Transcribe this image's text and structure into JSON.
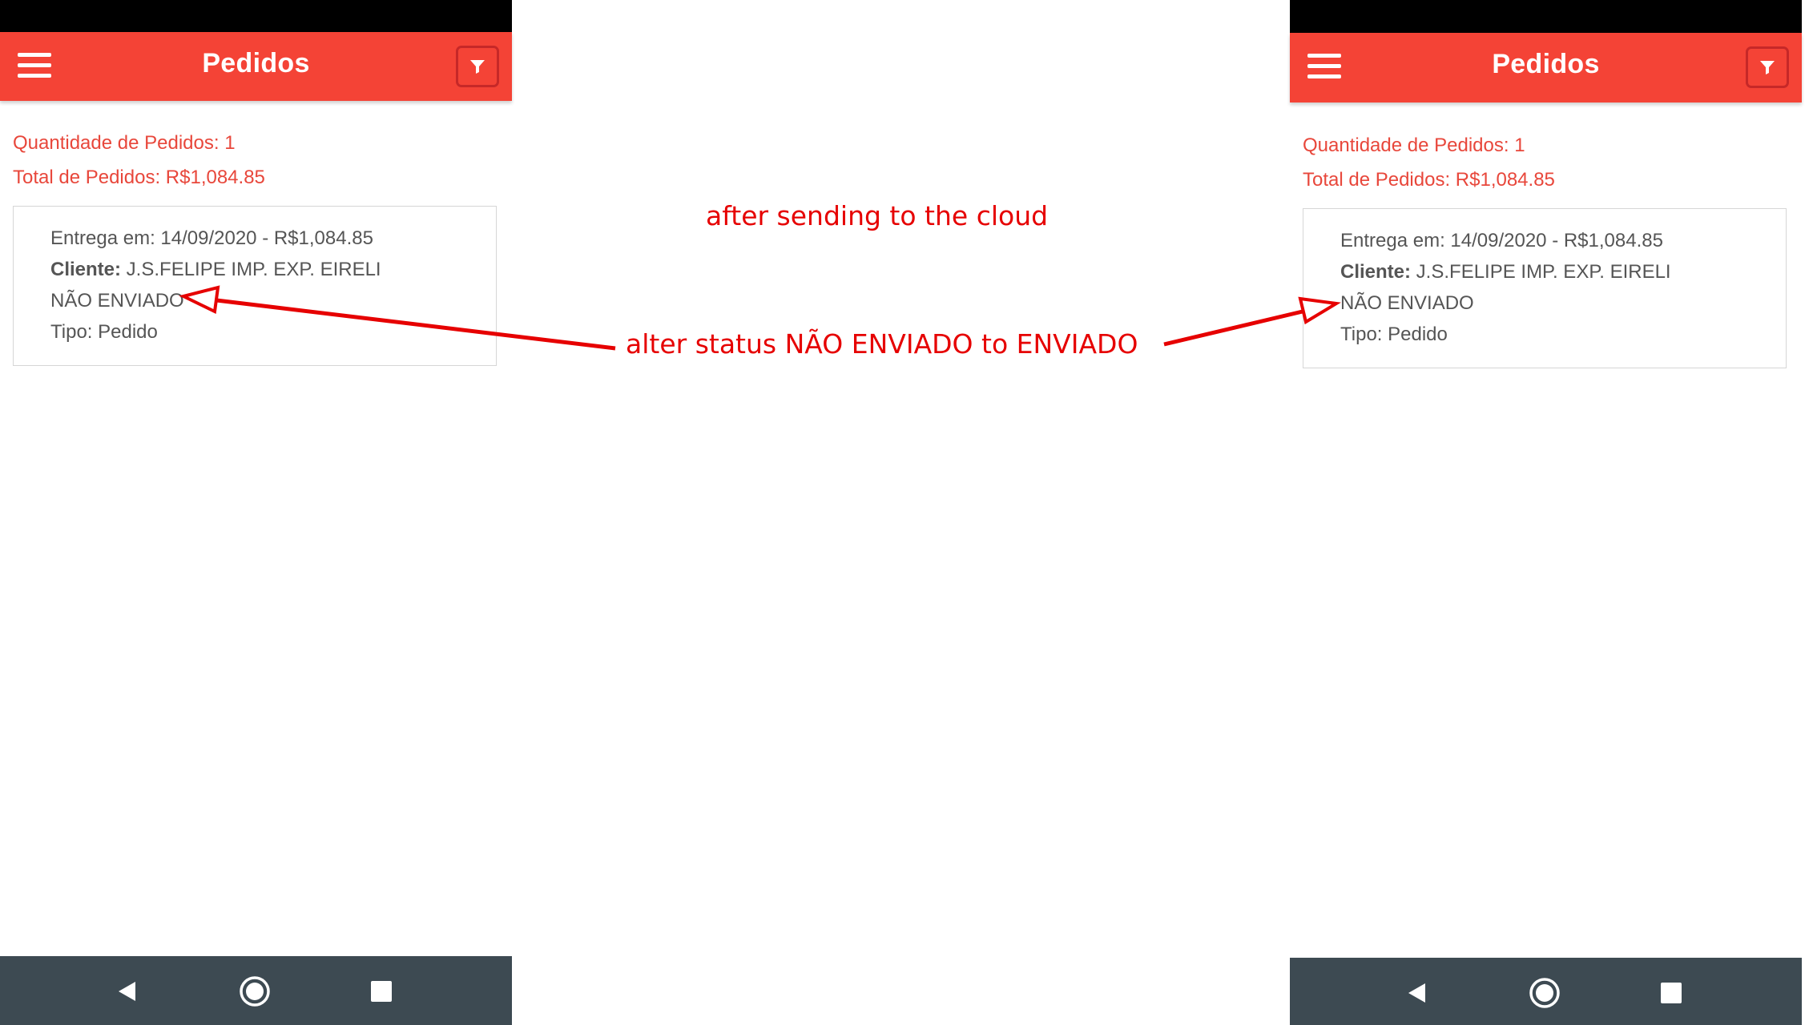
{
  "app": {
    "title": "Pedidos",
    "accent_color": "#f44336",
    "summary_color": "#e8473b",
    "nav_bar_color": "#3d4a52",
    "annotation_color": "#e60000"
  },
  "summary": {
    "count_label": "Quantidade de Pedidos: 1",
    "total_label": "Total de Pedidos: R$1,084.85"
  },
  "order": {
    "delivery_line": "Entrega em: 14/09/2020 - R$1,084.85",
    "client_label": "Cliente:",
    "client_name": " J.S.FELIPE IMP. EXP. EIRELI",
    "status": "NÃO ENVIADO",
    "type_line": "Tipo: Pedido"
  },
  "annotations": {
    "top_note": "after sending to the cloud",
    "arrow_note": "alter status NÃO ENVIADO to ENVIADO"
  },
  "icons": {
    "menu": "hamburger-menu-icon",
    "filter": "funnel-filter-icon",
    "back": "triangle-back-icon",
    "home": "circle-home-icon",
    "recents": "square-recents-icon"
  }
}
